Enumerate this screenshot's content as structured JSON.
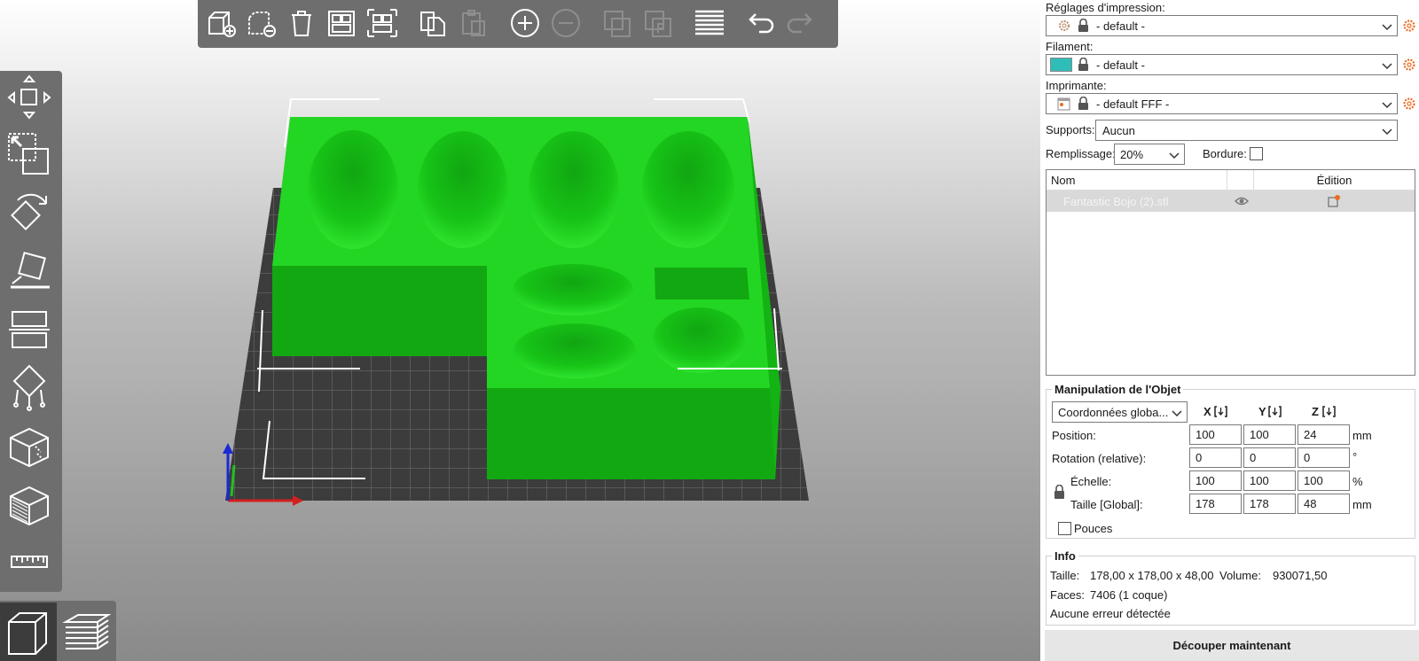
{
  "viewport": {
    "model_color": "#1ee61e",
    "bed_color": "#3c3c3c"
  },
  "top_toolbar": {
    "icons": [
      "add-icon",
      "delete-icon",
      "delete-all-icon",
      "arrange-icon",
      "arrange-selection-icon",
      "copy-icon",
      "paste-icon",
      "add-instance-icon",
      "remove-instance-icon",
      "split-objects-icon",
      "split-parts-icon",
      "layers-editing-icon",
      "undo-icon",
      "redo-icon"
    ]
  },
  "left_toolbar": {
    "icons": [
      "move-icon",
      "scale-icon",
      "rotate-icon",
      "place-on-face-icon",
      "cut-icon",
      "support-points-icon",
      "seam-painting-icon",
      "mmu-painting-icon",
      "measure-icon"
    ]
  },
  "view_switch": {
    "icons": [
      "3d-view-icon",
      "preview-layers-icon"
    ]
  },
  "panel": {
    "print_settings_label": "Réglages d'impression:",
    "print_settings_value": "- default -",
    "filament_label": "Filament:",
    "filament_value": "- default -",
    "filament_color": "#2fbdb8",
    "printer_label": "Imprimante:",
    "printer_value": "- default FFF -",
    "supports_label": "Supports:",
    "supports_value": "Aucun",
    "infill_label": "Remplissage:",
    "infill_value": "20%",
    "brim_label": "Bordure:",
    "accent_color": "#ed6b21"
  },
  "object_list": {
    "col_name": "Nom",
    "col_edit": "Édition",
    "rows": [
      {
        "name": "Fantastic Bojo (2).stl"
      }
    ]
  },
  "manipulation": {
    "title": "Manipulation de l'Objet",
    "coord_mode": "Coordonnées globa...",
    "axes": [
      "X",
      "Y",
      "Z"
    ],
    "position_label": "Position:",
    "position": [
      "100",
      "100",
      "24"
    ],
    "position_unit": "mm",
    "rotation_label": "Rotation (relative):",
    "rotation": [
      "0",
      "0",
      "0"
    ],
    "rotation_unit": "°",
    "scale_label": "Échelle:",
    "scale": [
      "100",
      "100",
      "100"
    ],
    "scale_unit": "%",
    "size_label": "Taille [Global]:",
    "size": [
      "178",
      "178",
      "48"
    ],
    "size_unit": "mm",
    "inches_label": "Pouces"
  },
  "info": {
    "title": "Info",
    "size_label": "Taille:",
    "size_value": "178,00 x 178,00 x 48,00",
    "volume_label": "Volume:",
    "volume_value": "930071,50",
    "faces_label": "Faces:",
    "faces_value": "7406 (1 coque)",
    "errors": "Aucune erreur détectée"
  },
  "slice_button": "Découper maintenant"
}
